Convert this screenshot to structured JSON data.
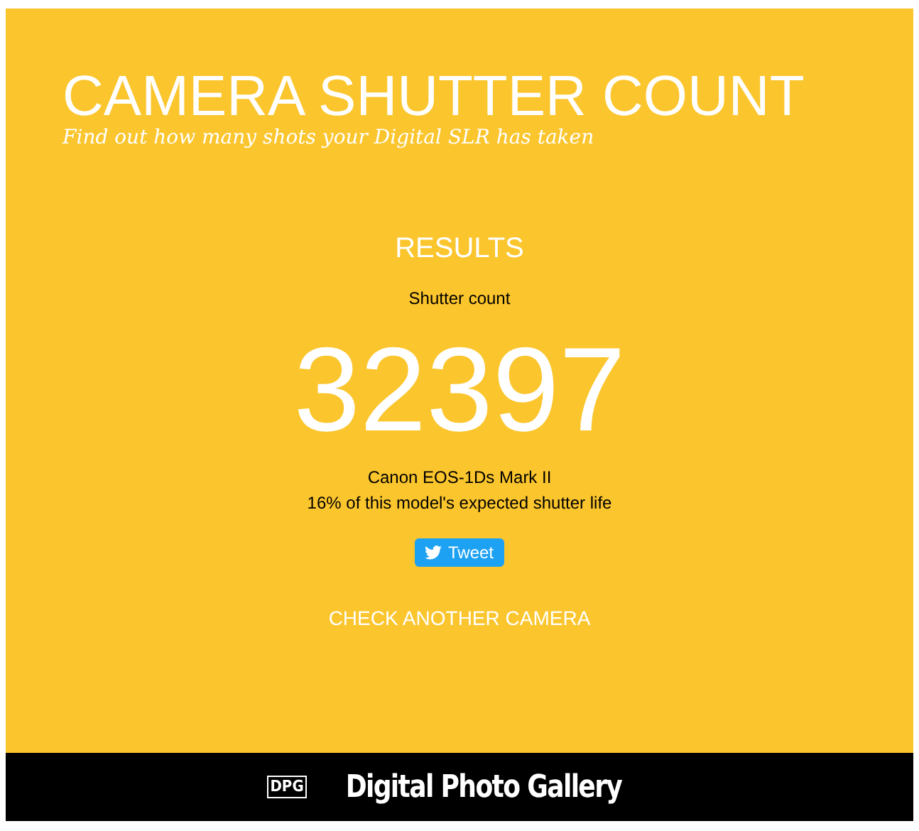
{
  "header": {
    "title": "CAMERA SHUTTER COUNT",
    "subtitle": "Find out how many shots your Digital SLR has taken"
  },
  "results": {
    "heading": "RESULTS",
    "label": "Shutter count",
    "count": "32397",
    "model": "Canon EOS-1Ds Mark II",
    "life": "16% of this model's expected shutter life",
    "tweet": "Tweet",
    "again": "CHECK ANOTHER CAMERA"
  },
  "footer": {
    "logo_mark": "DPG",
    "logo_text": "Digital Photo Gallery"
  }
}
